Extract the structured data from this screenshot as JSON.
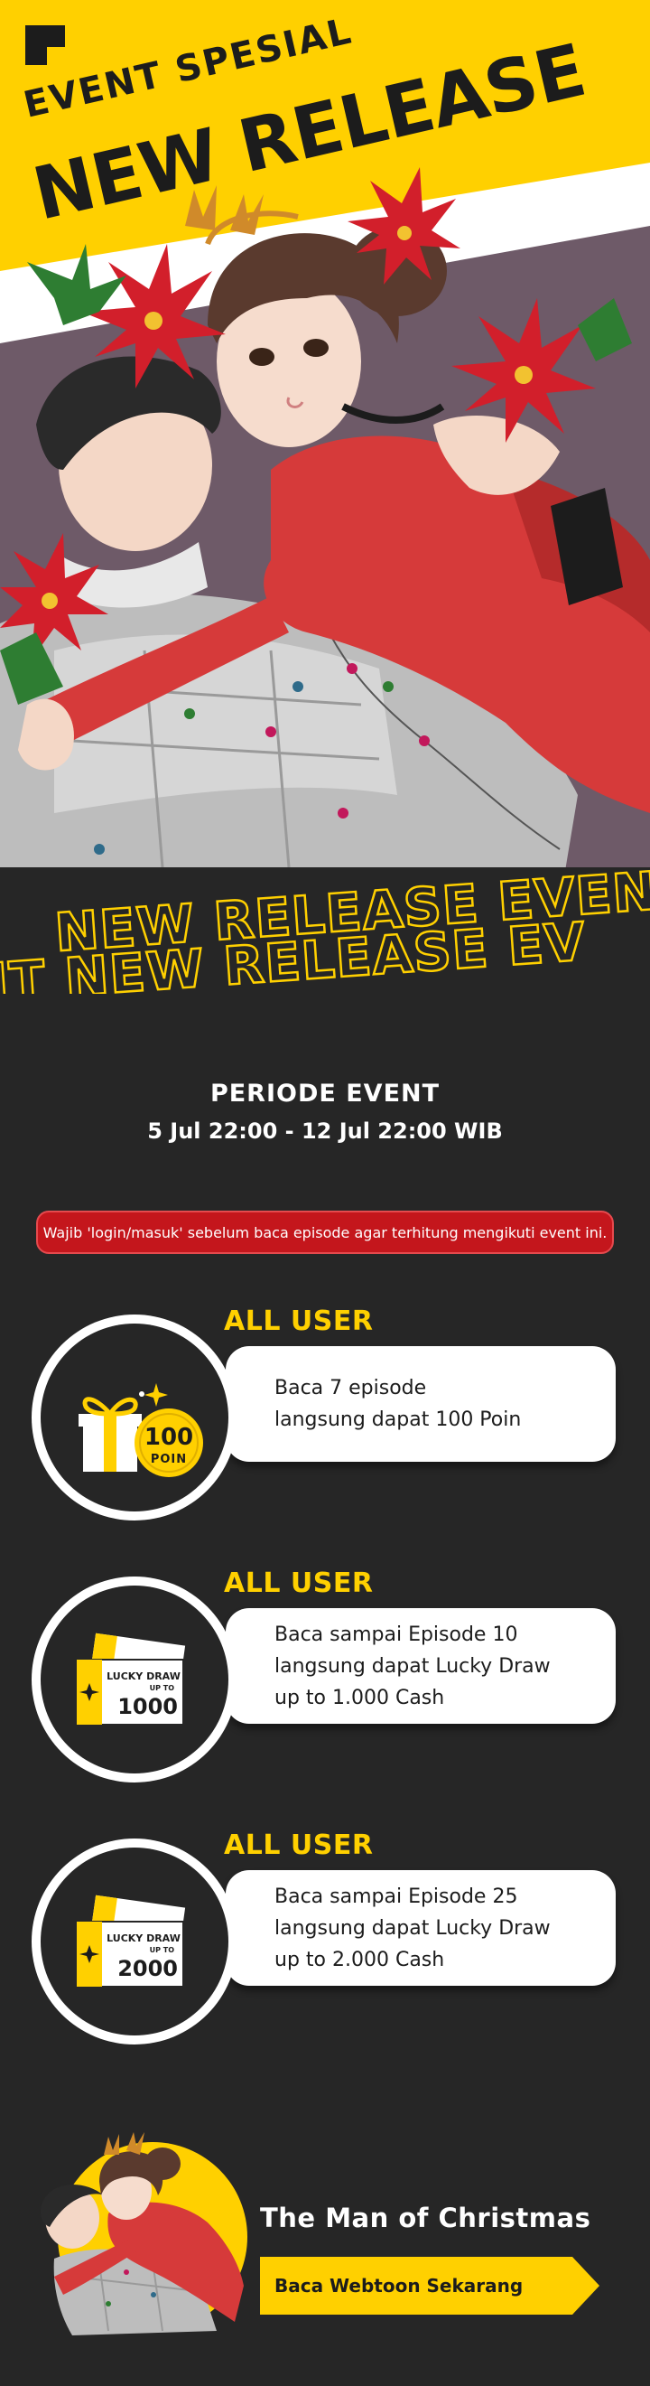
{
  "hero": {
    "title_line1": "EVENT SPESIAL",
    "title_line2": "NEW RELEASE",
    "band_line1": "NEW RELEASE EVENT NE",
    "band_line2": "NT NEW RELEASE EV",
    "colors": {
      "yellow": "#ffd000",
      "dark": "#262626"
    }
  },
  "period": {
    "title": "PERIODE EVENT",
    "dates": "5 Jul 22:00 - 12 Jul 22:00 WIB"
  },
  "notice": {
    "text": "Wajib 'login/masuk' sebelum baca episode agar terhitung mengikuti event ini.",
    "color": "#c4161c"
  },
  "rewards": [
    {
      "label": "ALL USER",
      "icon": "gift-coin-icon",
      "icon_text_num": "100",
      "icon_text_unit": "POIN",
      "lines": [
        "Baca 7 episode",
        "langsung dapat 100 Poin"
      ]
    },
    {
      "label": "ALL USER",
      "icon": "lucky-draw-ticket-icon",
      "icon_text_top": "LUCKY DRAW",
      "icon_text_small": "UP TO",
      "icon_text_num": "1000",
      "lines": [
        "Baca sampai Episode 10",
        "langsung dapat Lucky Draw",
        "up to 1.000 Cash"
      ]
    },
    {
      "label": "ALL USER",
      "icon": "lucky-draw-ticket-icon",
      "icon_text_top": "LUCKY DRAW",
      "icon_text_small": "UP TO",
      "icon_text_num": "2000",
      "lines": [
        "Baca sampai Episode 25",
        "langsung dapat Lucky Draw",
        "up to 2.000 Cash"
      ]
    }
  ],
  "footer": {
    "title": "The Man of Christmas",
    "cta_label": "Baca Webtoon Sekarang"
  }
}
